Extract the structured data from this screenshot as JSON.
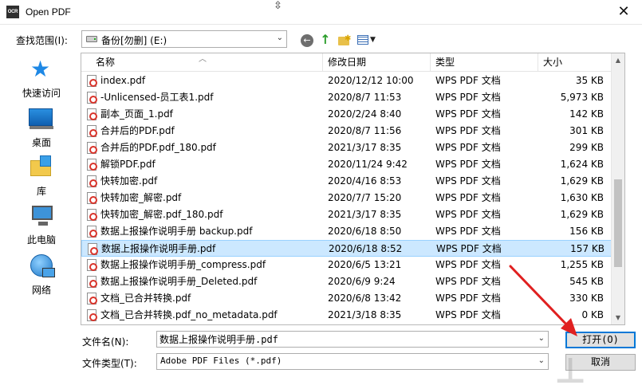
{
  "window": {
    "app_icon_text": "OCR",
    "title": "Open PDF",
    "close_glyph": "✕"
  },
  "look_in": {
    "label": "查找范围(I):",
    "value": "备份[勿删] (E:)"
  },
  "places": [
    {
      "label": "快速访问",
      "icon": "quick-access-icon"
    },
    {
      "label": "桌面",
      "icon": "desktop-icon"
    },
    {
      "label": "库",
      "icon": "libraries-icon"
    },
    {
      "label": "此电脑",
      "icon": "this-pc-icon"
    },
    {
      "label": "网络",
      "icon": "network-icon"
    }
  ],
  "columns": {
    "name": "名称",
    "date": "修改日期",
    "type": "类型",
    "size": "大小"
  },
  "files": [
    {
      "name": "index.pdf",
      "date": "2020/12/12 10:00",
      "type": "WPS PDF 文档",
      "size": "35 KB"
    },
    {
      "name": "-Unlicensed-员工表1.pdf",
      "date": "2020/8/7 11:53",
      "type": "WPS PDF 文档",
      "size": "5,973 KB"
    },
    {
      "name": "副本_页面_1.pdf",
      "date": "2020/2/24 8:40",
      "type": "WPS PDF 文档",
      "size": "142 KB"
    },
    {
      "name": "合并后的PDF.pdf",
      "date": "2020/8/7 11:56",
      "type": "WPS PDF 文档",
      "size": "301 KB"
    },
    {
      "name": "合并后的PDF.pdf_180.pdf",
      "date": "2021/3/17 8:35",
      "type": "WPS PDF 文档",
      "size": "299 KB"
    },
    {
      "name": "解锁PDF.pdf",
      "date": "2020/11/24 9:42",
      "type": "WPS PDF 文档",
      "size": "1,624 KB"
    },
    {
      "name": "快转加密.pdf",
      "date": "2020/4/16 8:53",
      "type": "WPS PDF 文档",
      "size": "1,629 KB"
    },
    {
      "name": "快转加密_解密.pdf",
      "date": "2020/7/7 15:20",
      "type": "WPS PDF 文档",
      "size": "1,630 KB"
    },
    {
      "name": "快转加密_解密.pdf_180.pdf",
      "date": "2021/3/17 8:35",
      "type": "WPS PDF 文档",
      "size": "1,629 KB"
    },
    {
      "name": "数据上报操作说明手册 backup.pdf",
      "date": "2020/6/18 8:50",
      "type": "WPS PDF 文档",
      "size": "156 KB"
    },
    {
      "name": "数据上报操作说明手册.pdf",
      "date": "2020/6/18 8:52",
      "type": "WPS PDF 文档",
      "size": "157 KB",
      "selected": true
    },
    {
      "name": "数据上报操作说明手册_compress.pdf",
      "date": "2020/6/5 13:21",
      "type": "WPS PDF 文档",
      "size": "1,255 KB"
    },
    {
      "name": "数据上报操作说明手册_Deleted.pdf",
      "date": "2020/6/9 9:24",
      "type": "WPS PDF 文档",
      "size": "545 KB"
    },
    {
      "name": "文档_已合并转换.pdf",
      "date": "2020/6/8 13:42",
      "type": "WPS PDF 文档",
      "size": "330 KB"
    },
    {
      "name": "文档_已合并转换.pdf_no_metadata.pdf",
      "date": "2021/3/18 8:35",
      "type": "WPS PDF 文档",
      "size": "0 KB"
    }
  ],
  "file_name": {
    "label": "文件名(N):",
    "value": "数据上报操作说明手册.pdf"
  },
  "file_type": {
    "label": "文件类型(T):",
    "value": "Adobe PDF Files (*.pdf)"
  },
  "buttons": {
    "open": "打开(O)",
    "cancel": "取消"
  },
  "colors": {
    "selection_bg": "#cce8ff",
    "selection_border": "#99d1ff",
    "default_button_border": "#0078d7",
    "annotation_arrow": "#e02020"
  }
}
